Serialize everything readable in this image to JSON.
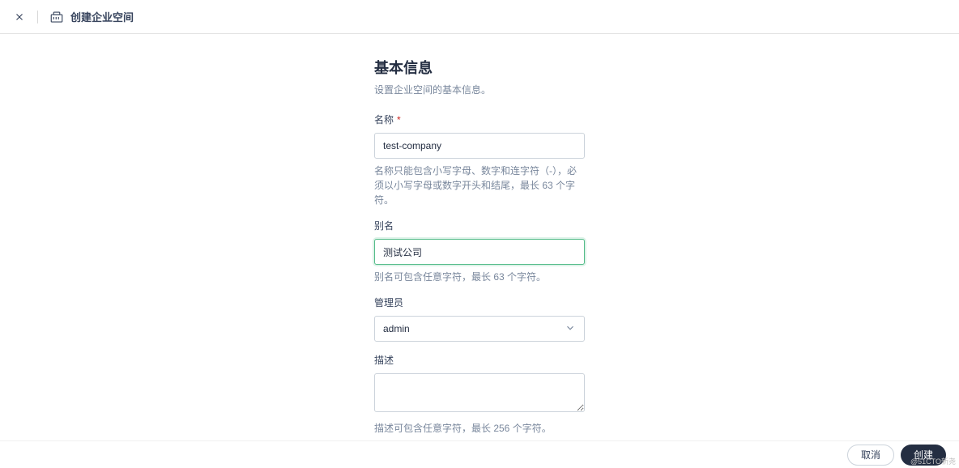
{
  "header": {
    "title": "创建企业空间"
  },
  "section": {
    "title": "基本信息",
    "subtitle": "设置企业空间的基本信息。"
  },
  "form": {
    "name": {
      "label": "名称",
      "value": "test-company",
      "help": "名称只能包含小写字母、数字和连字符（-），必须以小写字母或数字开头和结尾，最长 63 个字符。"
    },
    "alias": {
      "label": "别名",
      "value": "测试公司",
      "help": "别名可包含任意字符，最长 63 个字符。"
    },
    "admin": {
      "label": "管理员",
      "value": "admin"
    },
    "description": {
      "label": "描述",
      "value": "",
      "help": "描述可包含任意字符，最长 256 个字符。"
    }
  },
  "footer": {
    "cancel": "取消",
    "create": "创建"
  },
  "watermark": "@51CTO新尧"
}
